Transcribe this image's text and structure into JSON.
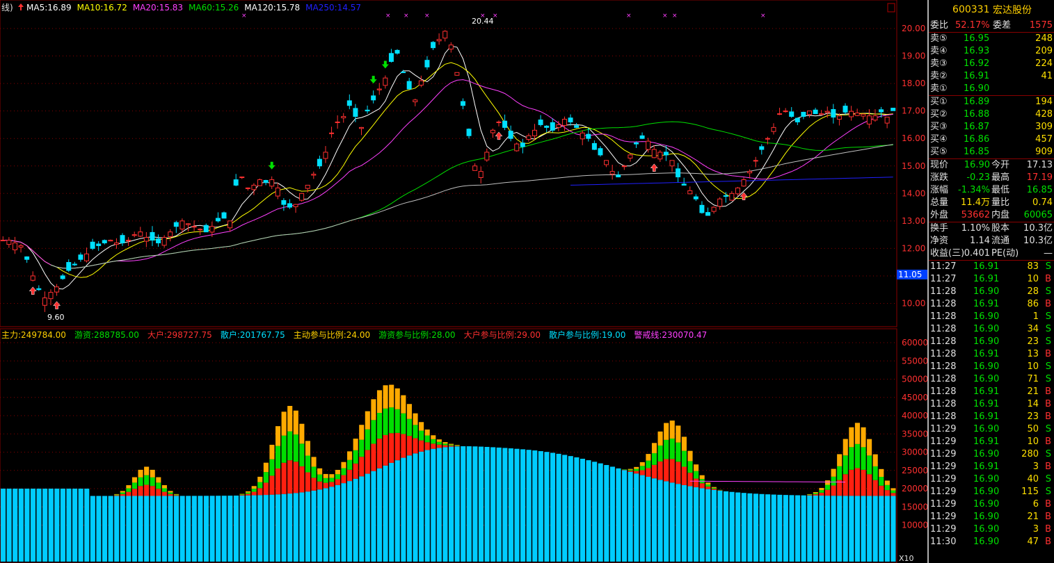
{
  "header": {
    "period_label": "线)",
    "ma": [
      {
        "label": "MA5:16.89",
        "color": "#ffffff"
      },
      {
        "label": "MA10:16.72",
        "color": "#ffff00"
      },
      {
        "label": "MA20:15.83",
        "color": "#ff40ff"
      },
      {
        "label": "MA60:15.26",
        "color": "#00e000"
      },
      {
        "label": "MA120:15.78",
        "color": "#ffffff"
      },
      {
        "label": "MA250:14.57",
        "color": "#2020ff"
      }
    ]
  },
  "price_axis": [
    "20.00",
    "19.00",
    "18.00",
    "17.00",
    "16.00",
    "15.00",
    "14.00",
    "13.00",
    "12.00",
    "11.00",
    "10.00"
  ],
  "price_cursor": "11.05",
  "peak_label": "20.44",
  "low_label": "9.60",
  "indicator_legend": [
    {
      "label": "主力:249784.00",
      "color": "#ffd000"
    },
    {
      "label": "游资:288785.00",
      "color": "#00e000"
    },
    {
      "label": "大户:298727.75",
      "color": "#ff3030"
    },
    {
      "label": "散户:201767.75",
      "color": "#00e0ff"
    },
    {
      "label": "主动参与比例:24.00",
      "color": "#ffd000"
    },
    {
      "label": "游资参与比例:28.00",
      "color": "#00e000"
    },
    {
      "label": "大户参与比例:29.00",
      "color": "#ff3030"
    },
    {
      "label": "散户参与比例:19.00",
      "color": "#00e0ff"
    },
    {
      "label": "警戒线:230070.47",
      "color": "#ff40ff"
    }
  ],
  "volume_axis": [
    "60000",
    "55000",
    "50000",
    "45000",
    "40000",
    "35000",
    "30000",
    "25000",
    "20000",
    "15000",
    "10000"
  ],
  "volume_scale": "X10",
  "quote": {
    "code": "600331",
    "name": "宏达股份",
    "weibi_label": "委比",
    "weibi": "52.17%",
    "weicha_label": "委差",
    "weicha": "1575",
    "asks": [
      {
        "label": "卖⑤",
        "price": "16.95",
        "vol": "248"
      },
      {
        "label": "卖④",
        "price": "16.93",
        "vol": "209"
      },
      {
        "label": "卖③",
        "price": "16.92",
        "vol": "224"
      },
      {
        "label": "卖②",
        "price": "16.91",
        "vol": "41"
      },
      {
        "label": "卖①",
        "price": "16.90",
        "vol": ""
      }
    ],
    "bids": [
      {
        "label": "买①",
        "price": "16.89",
        "vol": "194"
      },
      {
        "label": "买②",
        "price": "16.88",
        "vol": "428"
      },
      {
        "label": "买③",
        "price": "16.87",
        "vol": "309"
      },
      {
        "label": "买④",
        "price": "16.86",
        "vol": "457"
      },
      {
        "label": "买⑤",
        "price": "16.85",
        "vol": "909"
      }
    ],
    "stats": [
      {
        "l1": "现价",
        "v1": "16.90",
        "c1": "g",
        "l2": "今开",
        "v2": "17.13",
        "c2": "w"
      },
      {
        "l1": "涨跌",
        "v1": "-0.23",
        "c1": "g",
        "l2": "最高",
        "v2": "17.19",
        "c2": "r"
      },
      {
        "l1": "涨幅",
        "v1": "-1.34%",
        "c1": "g",
        "l2": "最低",
        "v2": "16.85",
        "c2": "g"
      },
      {
        "l1": "总量",
        "v1": "11.4万",
        "c1": "y",
        "l2": "量比",
        "v2": "0.74",
        "c2": "y"
      },
      {
        "l1": "外盘",
        "v1": "53662",
        "c1": "r",
        "l2": "内盘",
        "v2": "60065",
        "c2": "g"
      }
    ],
    "stats2": [
      {
        "l1": "换手",
        "v1": "1.10%",
        "c1": "w",
        "l2": "股本",
        "v2": "10.3亿",
        "c2": "w"
      },
      {
        "l1": "净资",
        "v1": "1.14",
        "c1": "w",
        "l2": "流通",
        "v2": "10.3亿",
        "c2": "w"
      },
      {
        "l1": "收益(三)",
        "v1": "0.401",
        "c1": "w",
        "l2": "PE(动)",
        "v2": "—",
        "c2": "w"
      }
    ],
    "ticks": [
      {
        "t": "11:27",
        "p": "16.91",
        "v": "83",
        "s": "S"
      },
      {
        "t": "11:27",
        "p": "16.91",
        "v": "10",
        "s": "B"
      },
      {
        "t": "11:28",
        "p": "16.90",
        "v": "28",
        "s": "S"
      },
      {
        "t": "11:28",
        "p": "16.91",
        "v": "86",
        "s": "B"
      },
      {
        "t": "11:28",
        "p": "16.90",
        "v": "1",
        "s": "S"
      },
      {
        "t": "11:28",
        "p": "16.90",
        "v": "34",
        "s": "S"
      },
      {
        "t": "11:28",
        "p": "16.90",
        "v": "23",
        "s": "S"
      },
      {
        "t": "11:28",
        "p": "16.91",
        "v": "13",
        "s": "B"
      },
      {
        "t": "11:28",
        "p": "16.90",
        "v": "10",
        "s": "S"
      },
      {
        "t": "11:28",
        "p": "16.90",
        "v": "71",
        "s": "S"
      },
      {
        "t": "11:28",
        "p": "16.91",
        "v": "21",
        "s": "B"
      },
      {
        "t": "11:28",
        "p": "16.91",
        "v": "14",
        "s": "B"
      },
      {
        "t": "11:28",
        "p": "16.91",
        "v": "23",
        "s": "B"
      },
      {
        "t": "11:29",
        "p": "16.90",
        "v": "50",
        "s": "S"
      },
      {
        "t": "11:29",
        "p": "16.91",
        "v": "10",
        "s": "B"
      },
      {
        "t": "11:29",
        "p": "16.90",
        "v": "280",
        "s": "S"
      },
      {
        "t": "11:29",
        "p": "16.91",
        "v": "3",
        "s": "B"
      },
      {
        "t": "11:29",
        "p": "16.90",
        "v": "40",
        "s": "S"
      },
      {
        "t": "11:29",
        "p": "16.90",
        "v": "115",
        "s": "S"
      },
      {
        "t": "11:29",
        "p": "16.90",
        "v": "6",
        "s": "B"
      },
      {
        "t": "11:29",
        "p": "16.90",
        "v": "21",
        "s": "B"
      },
      {
        "t": "11:29",
        "p": "16.90",
        "v": "3",
        "s": "B"
      },
      {
        "t": "11:30",
        "p": "16.90",
        "v": "47",
        "s": "B"
      }
    ]
  },
  "colors": {
    "up": "#ff3030",
    "down": "#00e0ff",
    "grid": "#8a0000",
    "retail": "#00ccff",
    "big": "#ff2010",
    "hot": "#00dd00",
    "main": "#ffaa00"
  }
}
